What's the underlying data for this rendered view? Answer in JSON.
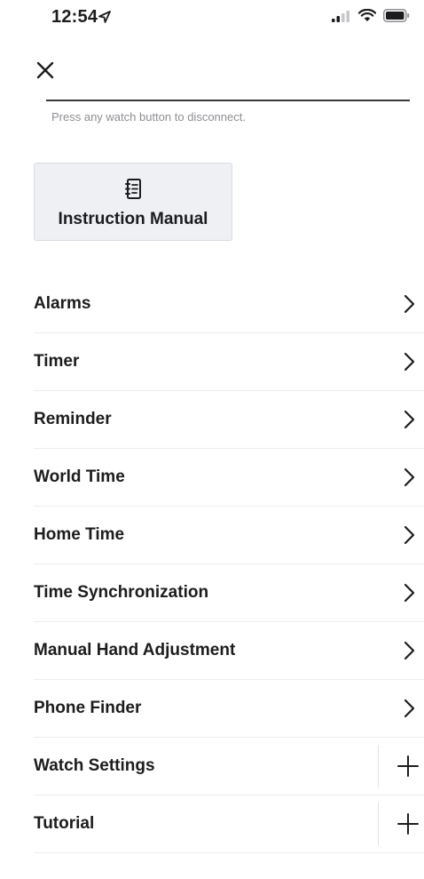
{
  "status_bar": {
    "time": "12:54",
    "location_icon": "location-arrow-icon",
    "signal_icon": "signal-icon",
    "wifi_icon": "wifi-icon",
    "battery_icon": "battery-icon"
  },
  "header": {
    "close_icon": "close-icon",
    "hint": "Press any watch button to disconnect."
  },
  "manual_card": {
    "icon": "manual-icon",
    "label": "Instruction Manual"
  },
  "menu": {
    "items": [
      {
        "label": "Alarms",
        "control": "chevron"
      },
      {
        "label": "Timer",
        "control": "chevron"
      },
      {
        "label": "Reminder",
        "control": "chevron"
      },
      {
        "label": "World Time",
        "control": "chevron"
      },
      {
        "label": "Home Time",
        "control": "chevron"
      },
      {
        "label": "Time Synchronization",
        "control": "chevron"
      },
      {
        "label": "Manual Hand Adjustment",
        "control": "chevron"
      },
      {
        "label": "Phone Finder",
        "control": "chevron"
      },
      {
        "label": "Watch Settings",
        "control": "plus"
      },
      {
        "label": "Tutorial",
        "control": "plus"
      }
    ]
  },
  "colors": {
    "text": "#1c1c1e",
    "hint": "#8e8e93",
    "card_bg": "#eef0f3",
    "divider": "#ececec"
  }
}
